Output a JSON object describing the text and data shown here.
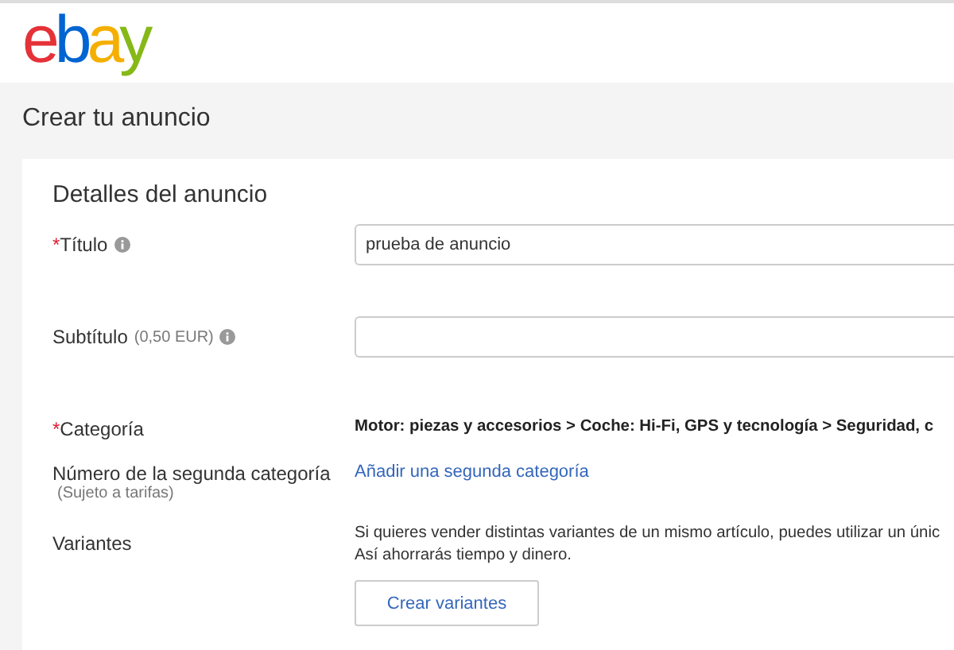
{
  "logo": [
    {
      "text": "e",
      "color": "#e53238"
    },
    {
      "text": "b",
      "color": "#0064d2"
    },
    {
      "text": "a",
      "color": "#f5af02"
    },
    {
      "text": "y",
      "color": "#86b817"
    }
  ],
  "page_title": "Crear tu anuncio",
  "section_title": "Detalles del anuncio",
  "rows": [
    {
      "kind": "input",
      "mark": "*",
      "label": "Título",
      "info": true,
      "value": "prueba de anuncio"
    },
    {
      "kind": "input",
      "label": "Subtítulo",
      "note": "(0,50 EUR)",
      "info": true,
      "value": ""
    },
    {
      "kind": "text",
      "mark": "*",
      "label": "Categoría",
      "info": false,
      "text": "Motor: piezas y accesorios > Coche: Hi-Fi, GPS y tecnología > Seguridad, c"
    },
    {
      "kind": "link",
      "label": "Número de la segunda categoría",
      "sublabel": "(Sujeto a tarifas)",
      "info": false,
      "link": "Añadir una segunda categoría"
    },
    {
      "kind": "variants",
      "label": "Variantes",
      "info": false,
      "lines": [
        "Si quieres vender distintas variantes de un mismo artículo, puedes utilizar un únic",
        "Así ahorrarás tiempo y dinero."
      ],
      "button": "Crear variantes"
    }
  ]
}
